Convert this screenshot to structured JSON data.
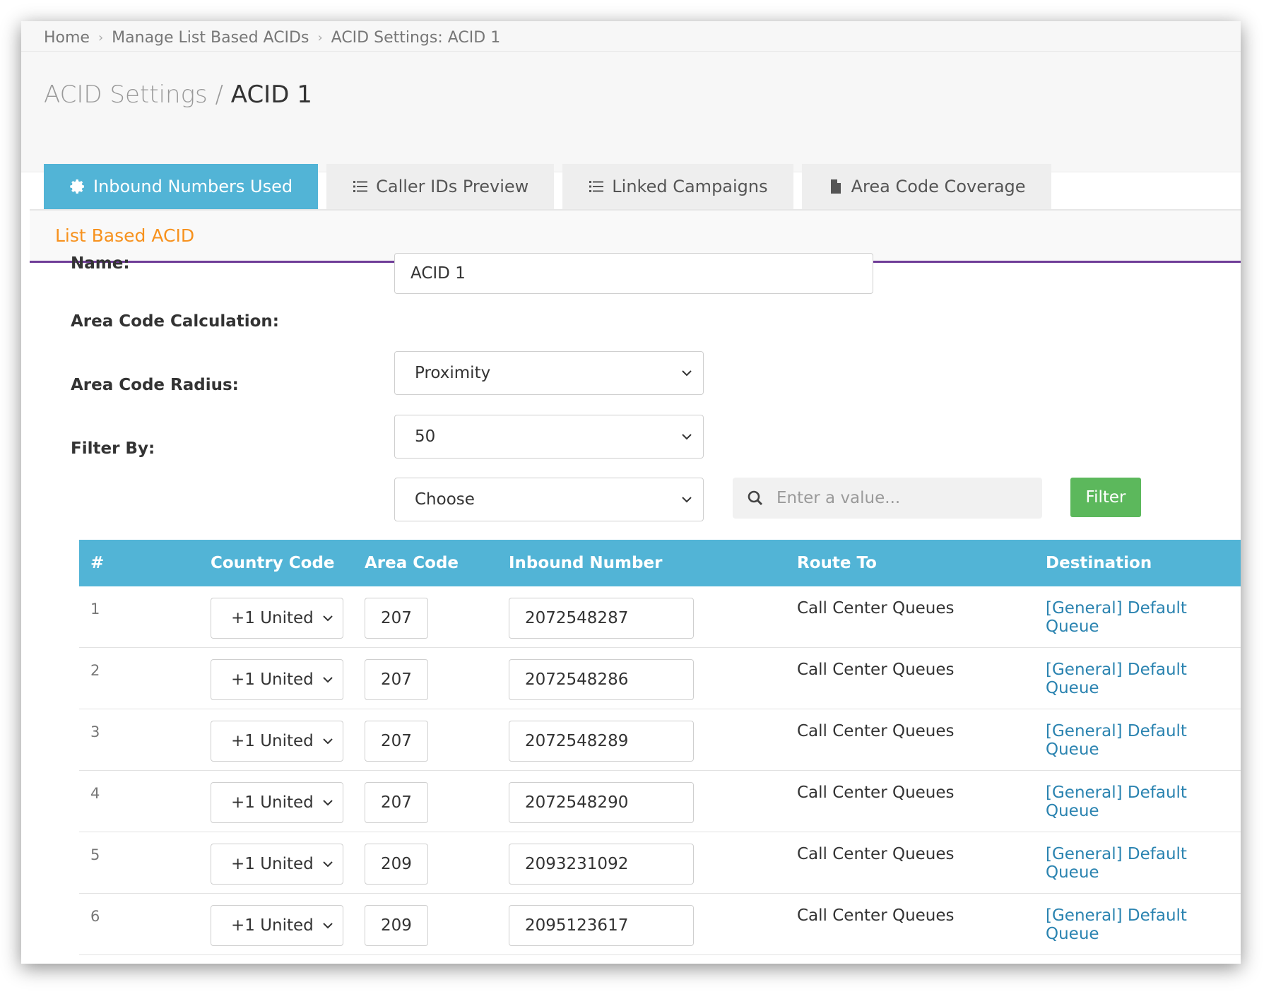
{
  "breadcrumb": {
    "items": [
      "Home",
      "Manage List Based ACIDs",
      "ACID Settings: ACID 1"
    ]
  },
  "page_title": {
    "prefix": "ACID Settings /",
    "name": "ACID 1"
  },
  "tabs": [
    {
      "label": "Inbound Numbers Used",
      "icon": "gear-icon",
      "active": true
    },
    {
      "label": "Caller IDs Preview",
      "icon": "list-icon",
      "active": false
    },
    {
      "label": "Linked Campaigns",
      "icon": "list-icon",
      "active": false
    },
    {
      "label": "Area Code Coverage",
      "icon": "document-icon",
      "active": false
    }
  ],
  "panel": {
    "title": "List Based ACID"
  },
  "form": {
    "name_label": "Name:",
    "name_value": "ACID 1",
    "calc_label": "Area Code Calculation:",
    "calc_value": "Proximity",
    "radius_label": "Area Code Radius:",
    "radius_value": "50",
    "filter_label": "Filter By:",
    "filter_value": "Choose",
    "search_placeholder": "Enter a value...",
    "filter_button": "Filter"
  },
  "table": {
    "headers": [
      "#",
      "Country Code",
      "Area Code",
      "Inbound Number",
      "Route To",
      "Destination"
    ],
    "rows": [
      {
        "num": "1",
        "country": "+1 United",
        "area": "207",
        "number": "2072548287",
        "route": "Call Center Queues",
        "dest": "[General] Default Queue"
      },
      {
        "num": "2",
        "country": "+1 United",
        "area": "207",
        "number": "2072548286",
        "route": "Call Center Queues",
        "dest": "[General] Default Queue"
      },
      {
        "num": "3",
        "country": "+1 United",
        "area": "207",
        "number": "2072548289",
        "route": "Call Center Queues",
        "dest": "[General] Default Queue"
      },
      {
        "num": "4",
        "country": "+1 United",
        "area": "207",
        "number": "2072548290",
        "route": "Call Center Queues",
        "dest": "[General] Default Queue"
      },
      {
        "num": "5",
        "country": "+1 United",
        "area": "209",
        "number": "2093231092",
        "route": "Call Center Queues",
        "dest": "[General] Default Queue"
      },
      {
        "num": "6",
        "country": "+1 United",
        "area": "209",
        "number": "2095123617",
        "route": "Call Center Queues",
        "dest": "[General] Default Queue"
      }
    ]
  },
  "colors": {
    "tab_active": "#52b4d6",
    "panel_title": "#f7921e",
    "panel_border": "#6f3c97",
    "filter_button": "#5cb85c",
    "link": "#2a83b0"
  }
}
